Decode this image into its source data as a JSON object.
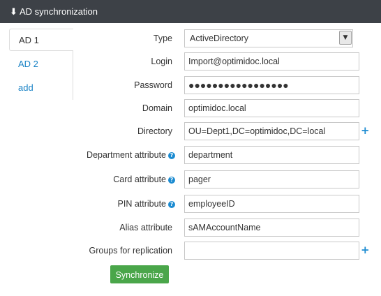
{
  "header": {
    "title": "AD synchronization",
    "icon": "arrow-down-icon"
  },
  "tabs": [
    {
      "label": "AD 1"
    },
    {
      "label": "AD 2"
    },
    {
      "label": "add"
    }
  ],
  "form": {
    "type": {
      "label": "Type",
      "value": "ActiveDirectory"
    },
    "login": {
      "label": "Login",
      "value": "Import@optimidoc.local"
    },
    "password": {
      "label": "Password",
      "value": "●●●●●●●●●●●●●●●●●"
    },
    "domain": {
      "label": "Domain",
      "value": "optimidoc.local"
    },
    "directory": {
      "label": "Directory",
      "value": "OU=Dept1,DC=optimidoc,DC=local"
    },
    "department": {
      "label": "Department attribute",
      "value": "department"
    },
    "card": {
      "label": "Card attribute",
      "value": "pager"
    },
    "pin": {
      "label": "PIN attribute",
      "value": "employeeID"
    },
    "alias": {
      "label": "Alias attribute",
      "value": "sAMAccountName"
    },
    "groups": {
      "label": "Groups for replication",
      "value": ""
    }
  },
  "icons": {
    "help": "question-circle-icon",
    "add": "plus-icon",
    "dropdown": "chevron-down-icon"
  },
  "glyphs": {
    "header_arrow": "🡓",
    "help": "?",
    "plus": "+",
    "dropdown": "▼"
  },
  "actions": {
    "synchronize_label": "Synchronize"
  },
  "colors": {
    "header_bg": "#3d4147",
    "link": "#1a83c6",
    "button_bg": "#4aa64a",
    "help_icon": "#1b8bd1"
  }
}
